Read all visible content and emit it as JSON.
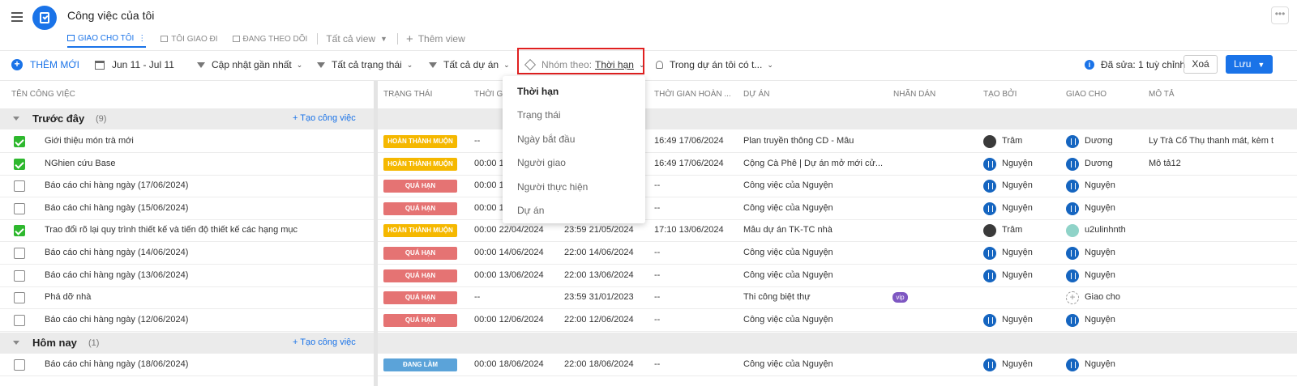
{
  "header": {
    "title": "Công việc của tôi",
    "tabs": [
      {
        "label": "GIAO CHO TÔI",
        "active": true
      },
      {
        "label": "TÔI GIAO ĐI",
        "active": false
      },
      {
        "label": "ĐANG THEO DÕI",
        "active": false
      }
    ],
    "all_views": "Tất cả view",
    "add_view": "Thêm view"
  },
  "toolbar": {
    "add_label": "THÊM MỚI",
    "date_range": "Jun 11 - Jul 11",
    "sort": "Cập nhật gần nhất",
    "status_filter": "Tất cả trạng thái",
    "project_filter": "Tất cả dự án",
    "group_prefix": "Nhóm theo:",
    "group_value": "Thời hạn",
    "scope": "Trong dự án tôi có t...",
    "edited_note": "Đã sửa: 1 tuỳ chỉnh",
    "delete_label": "Xoá",
    "save_label": "Lưu"
  },
  "columns": [
    "TÊN CÔNG VIỆC",
    "TRẠNG THÁI",
    "THỜI GI",
    "THỜI GIAN HOÀN ...",
    "DỰ ÁN",
    "NHÃN DÁN",
    "TẠO BỞI",
    "GIAO CHO",
    "MÔ TẢ"
  ],
  "dropdown": {
    "options": [
      "Thời hạn",
      "Trạng thái",
      "Ngày bắt đầu",
      "Người giao",
      "Người thực hiện",
      "Dự án"
    ],
    "selected": "Thời hạn"
  },
  "groups": [
    {
      "name": "Trước đây",
      "count": "(9)",
      "create_label": "+ Tạo công việc"
    },
    {
      "name": "Hôm nay",
      "count": "(1)",
      "create_label": "+ Tạo công việc"
    }
  ],
  "colors": {
    "accent": "#1a73e8",
    "late_done": "#f5b800",
    "overdue": "#e57373",
    "in_progress": "#5ba3d9",
    "done_check": "#2eb82e",
    "highlight": "#e02020"
  },
  "rows": [
    {
      "checked": true,
      "name": "Giới thiệu món trà mới",
      "status": "HOÀN THÀNH MUỘN",
      "start": "--",
      "due": "",
      "completed": "16:49 17/06/2024",
      "project": "Plan truyền thông CD - Mâu",
      "tag": "",
      "creator": "Trâm",
      "creator_avatar": "dark",
      "assignee": "Dương",
      "assignee_avatar": "blue",
      "desc": "Ly Trà Cổ Thụ thanh mát, kèm t"
    },
    {
      "checked": true,
      "name": "NGhien cứu Base",
      "status": "HOÀN THÀNH MUỘN",
      "start": "00:00 1",
      "due": "",
      "completed": "16:49 17/06/2024",
      "project": "Cộng Cà Phê | Dự án mở mới cử...",
      "tag": "",
      "creator": "Nguyện",
      "creator_avatar": "blue",
      "assignee": "Dương",
      "assignee_avatar": "blue",
      "desc": "Mô tả12"
    },
    {
      "checked": false,
      "name": "Báo cáo chi hàng ngày (17/06/2024)",
      "status": "QUÁ HẠN",
      "start": "00:00 1",
      "due": "",
      "completed": "--",
      "project": "Công việc của Nguyện",
      "tag": "",
      "creator": "Nguyện",
      "creator_avatar": "blue",
      "assignee": "Nguyện",
      "assignee_avatar": "blue",
      "desc": ""
    },
    {
      "checked": false,
      "name": "Báo cáo chi hàng ngày (15/06/2024)",
      "status": "QUÁ HẠN",
      "start": "00:00 1",
      "due": "",
      "completed": "--",
      "project": "Công việc của Nguyện",
      "tag": "",
      "creator": "Nguyện",
      "creator_avatar": "blue",
      "assignee": "Nguyện",
      "assignee_avatar": "blue",
      "desc": ""
    },
    {
      "checked": true,
      "name": "Trao đổi rõ lại quy trình thiết kế và tiến độ thiết kế các hạng mục",
      "status": "HOÀN THÀNH MUỘN",
      "start": "00:00 22/04/2024",
      "due": "23:59 21/05/2024",
      "completed": "17:10 13/06/2024",
      "project": "Mẫu dự án TK-TC nhà",
      "tag": "",
      "creator": "Trâm",
      "creator_avatar": "dark",
      "assignee": "u2ulinhnth",
      "assignee_avatar": "teal",
      "desc": ""
    },
    {
      "checked": false,
      "name": "Báo cáo chi hàng ngày (14/06/2024)",
      "status": "QUÁ HẠN",
      "start": "00:00 14/06/2024",
      "due": "22:00 14/06/2024",
      "completed": "--",
      "project": "Công việc của Nguyện",
      "tag": "",
      "creator": "Nguyện",
      "creator_avatar": "blue",
      "assignee": "Nguyện",
      "assignee_avatar": "blue",
      "desc": ""
    },
    {
      "checked": false,
      "name": "Báo cáo chi hàng ngày (13/06/2024)",
      "status": "QUÁ HẠN",
      "start": "00:00 13/06/2024",
      "due": "22:00 13/06/2024",
      "completed": "--",
      "project": "Công việc của Nguyện",
      "tag": "",
      "creator": "Nguyện",
      "creator_avatar": "blue",
      "assignee": "Nguyện",
      "assignee_avatar": "blue",
      "desc": ""
    },
    {
      "checked": false,
      "name": "Phá dỡ nhà",
      "status": "QUÁ HẠN",
      "start": "--",
      "due": "23:59 31/01/2023",
      "completed": "--",
      "project": "Thi công biệt thự",
      "tag": "vip",
      "creator": "",
      "creator_avatar": "",
      "assignee": "Giao cho",
      "assignee_avatar": "dashed",
      "desc": ""
    },
    {
      "checked": false,
      "name": "Báo cáo chi hàng ngày (12/06/2024)",
      "status": "QUÁ HẠN",
      "start": "00:00 12/06/2024",
      "due": "22:00 12/06/2024",
      "completed": "--",
      "project": "Công việc của Nguyện",
      "tag": "",
      "creator": "Nguyện",
      "creator_avatar": "blue",
      "assignee": "Nguyện",
      "assignee_avatar": "blue",
      "desc": ""
    },
    {
      "checked": false,
      "name": "Báo cáo chi hàng ngày (18/06/2024)",
      "status": "ĐANG LÀM",
      "start": "00:00 18/06/2024",
      "due": "22:00 18/06/2024",
      "completed": "--",
      "project": "Công việc của Nguyện",
      "tag": "",
      "creator": "Nguyện",
      "creator_avatar": "blue",
      "assignee": "Nguyện",
      "assignee_avatar": "blue",
      "desc": ""
    }
  ]
}
